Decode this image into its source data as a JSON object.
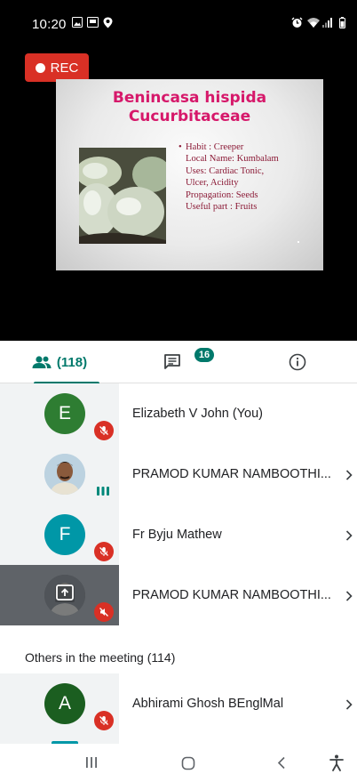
{
  "status_bar": {
    "time": "10:20"
  },
  "recording": {
    "label": "REC",
    "color": "#d93025"
  },
  "slide": {
    "title_line1": "Benincasa hispida",
    "title_line2": "Cucurbitaceae",
    "bullet_marker": "•",
    "lines": [
      "Habit : Creeper",
      "Local Name:  Kumbalam",
      "Uses: Cardiac Tonic,",
      "Ulcer, Acidity",
      "Propagation: Seeds",
      "Useful part : Fruits"
    ],
    "title_color": "#d6186a",
    "text_color": "#8b1a36"
  },
  "tabs": {
    "people_count": "(118)",
    "chat_badge": "16",
    "accent_color": "#00796b"
  },
  "participants": [
    {
      "initial": "E",
      "name": "Elizabeth V John (You)",
      "avatar_color": "#2e7d32",
      "mic": "muted"
    },
    {
      "initial": "",
      "name": "PRAMOD KUMAR NAMBOOTHI...",
      "mic": "speaking"
    },
    {
      "initial": "F",
      "name": "Fr Byju Mathew",
      "avatar_color": "#0097a7",
      "mic": "muted"
    },
    {
      "initial": "",
      "name": "PRAMOD KUMAR NAMBOOTHI...",
      "mic": "muted",
      "presenting": true
    }
  ],
  "others": {
    "heading": "Others in the meeting (114)",
    "participants": [
      {
        "initial": "A",
        "name": "Abhirami Ghosh BEnglMal",
        "avatar_color": "#1b5e20",
        "mic": "muted"
      }
    ]
  }
}
